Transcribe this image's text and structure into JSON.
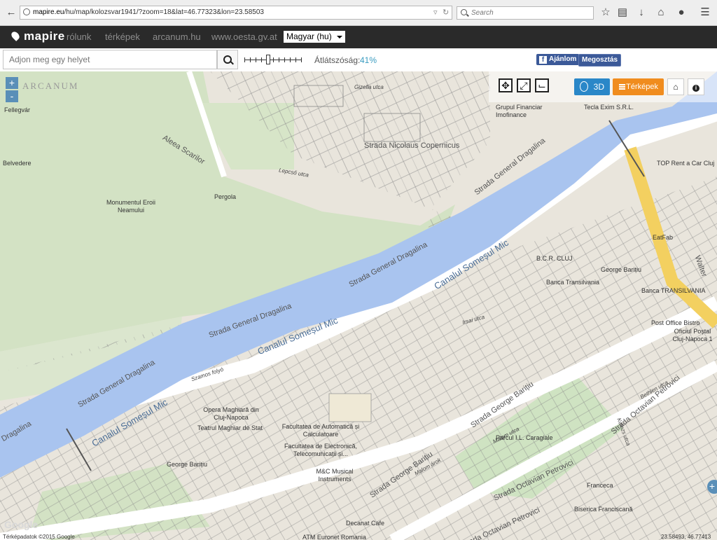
{
  "browser": {
    "url_host": "mapire.eu",
    "url_path": "/hu/map/kolozsvar1941/?zoom=18&lat=46.77323&lon=23.58503",
    "search_placeholder": "Search"
  },
  "site_nav": {
    "logo": "mapire",
    "links": [
      "rólunk",
      "térképek",
      "arcanum.hu",
      "www.oesta.gv.at"
    ],
    "language": "Magyar (hu)"
  },
  "toolbar": {
    "place_placeholder": "Adjon meg egy helyet",
    "opacity_label": "Átlátszóság:",
    "opacity_value": "41%",
    "opacity_fraction": 0.41,
    "like_label": "Ajánlom",
    "share_label": "Megosztás"
  },
  "map_panel": {
    "btn_3d": "3D",
    "btn_maps": "Térképek"
  },
  "map": {
    "watermark": "ARCANUM",
    "zoom_in": "+",
    "zoom_out": "-",
    "streets": [
      "Aleea Scarilor",
      "Strada General Dragalina",
      "Strada General Dragalina",
      "Strada General Dragalina",
      "Strada General Dragalina",
      "Strada General Dragalina",
      "Dragalina",
      "Strada George Barițiu",
      "Strada George Barițiu",
      "Strada George Barițiu",
      "Strada Octavian Petrovici",
      "Strada Octavian Petrovici",
      "Strada Octavian Petrovici",
      "Strada Nicolaus Copernicus",
      "Walter"
    ],
    "rivers": [
      "Canalul Someșul Mic",
      "Canalul Someșul Mic",
      "Canalul Someșul Mic",
      "Canalul Someșul Mic"
    ],
    "old_map_text": [
      "Szamos folyó",
      "Lepcső utca",
      "Gizella utca",
      "Malom árok",
      "Malom utca",
      "Bethlen utca",
      "Kolozs utca",
      "Attila utca",
      "Bérrelo utca",
      "Irsai utca"
    ],
    "pois": [
      "Fellegvár",
      "Belvedere",
      "Pergola",
      "Monumentul Eroii Neamului",
      "Grupul Financiar Imofinance",
      "Tecla Exim S.R.L.",
      "TOP Rent a Car Cluj",
      "EatFab",
      "B.C.R. CLUJ",
      "George Barițiu",
      "Banca Transilvania",
      "Banca TRANSILVANIA",
      "Post Office Bistro",
      "Oficiul Poștal Cluj-Napoca 1",
      "Opera Maghiară din Cluj-Napoca",
      "Teatrul Maghiar de Stat",
      "Facultatea de Automatică și Calculatoare",
      "Facultatea de Electronică, Telecomunicații și...",
      "M&C Musical Instruments",
      "George Barițiu",
      "Parcul I.L. Caragiale",
      "Franceca",
      "Biserica Franciscană",
      "Decanat Cafe",
      "ATM Euronet Romania"
    ],
    "google_logo": "Google",
    "attribution": "Térképadatok ©2015 Google",
    "coords": "23.58493, 46.77413"
  }
}
